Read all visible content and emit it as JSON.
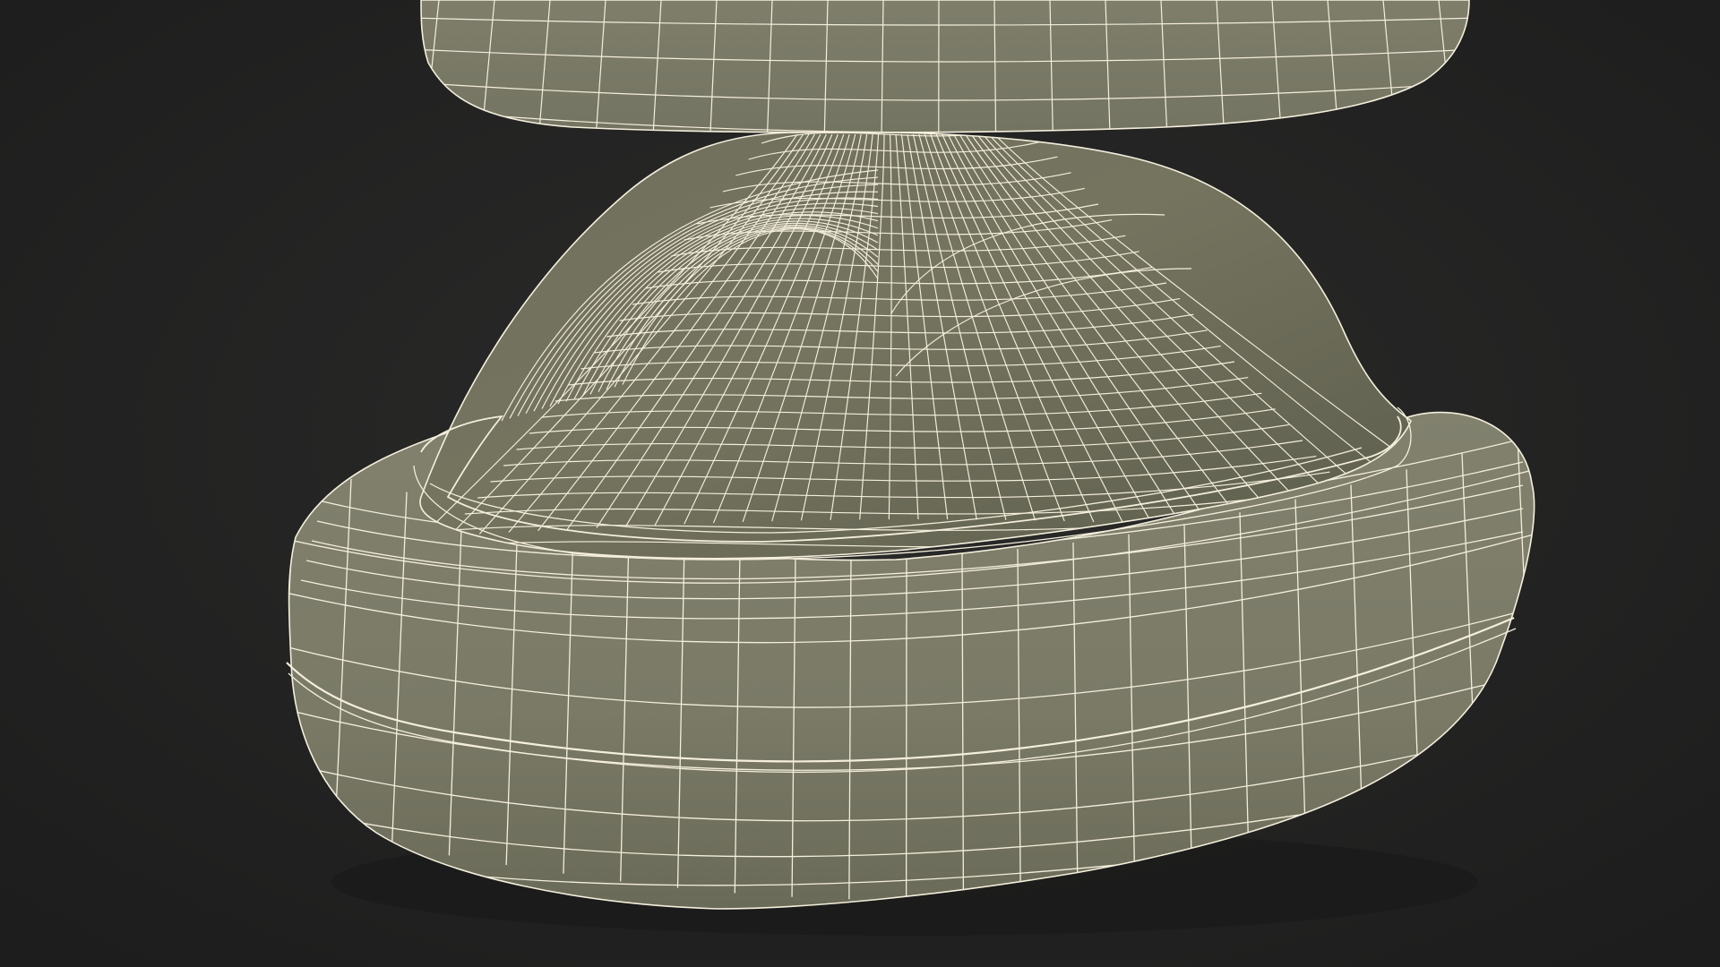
{
  "scene": {
    "background_color": "#232323",
    "surface_color": "#7d7d6b",
    "surface_shadow_color": "#5f5f50",
    "wire_color": "#f4efdc",
    "objects": [
      "top-disc",
      "dome",
      "base-cushion"
    ]
  }
}
